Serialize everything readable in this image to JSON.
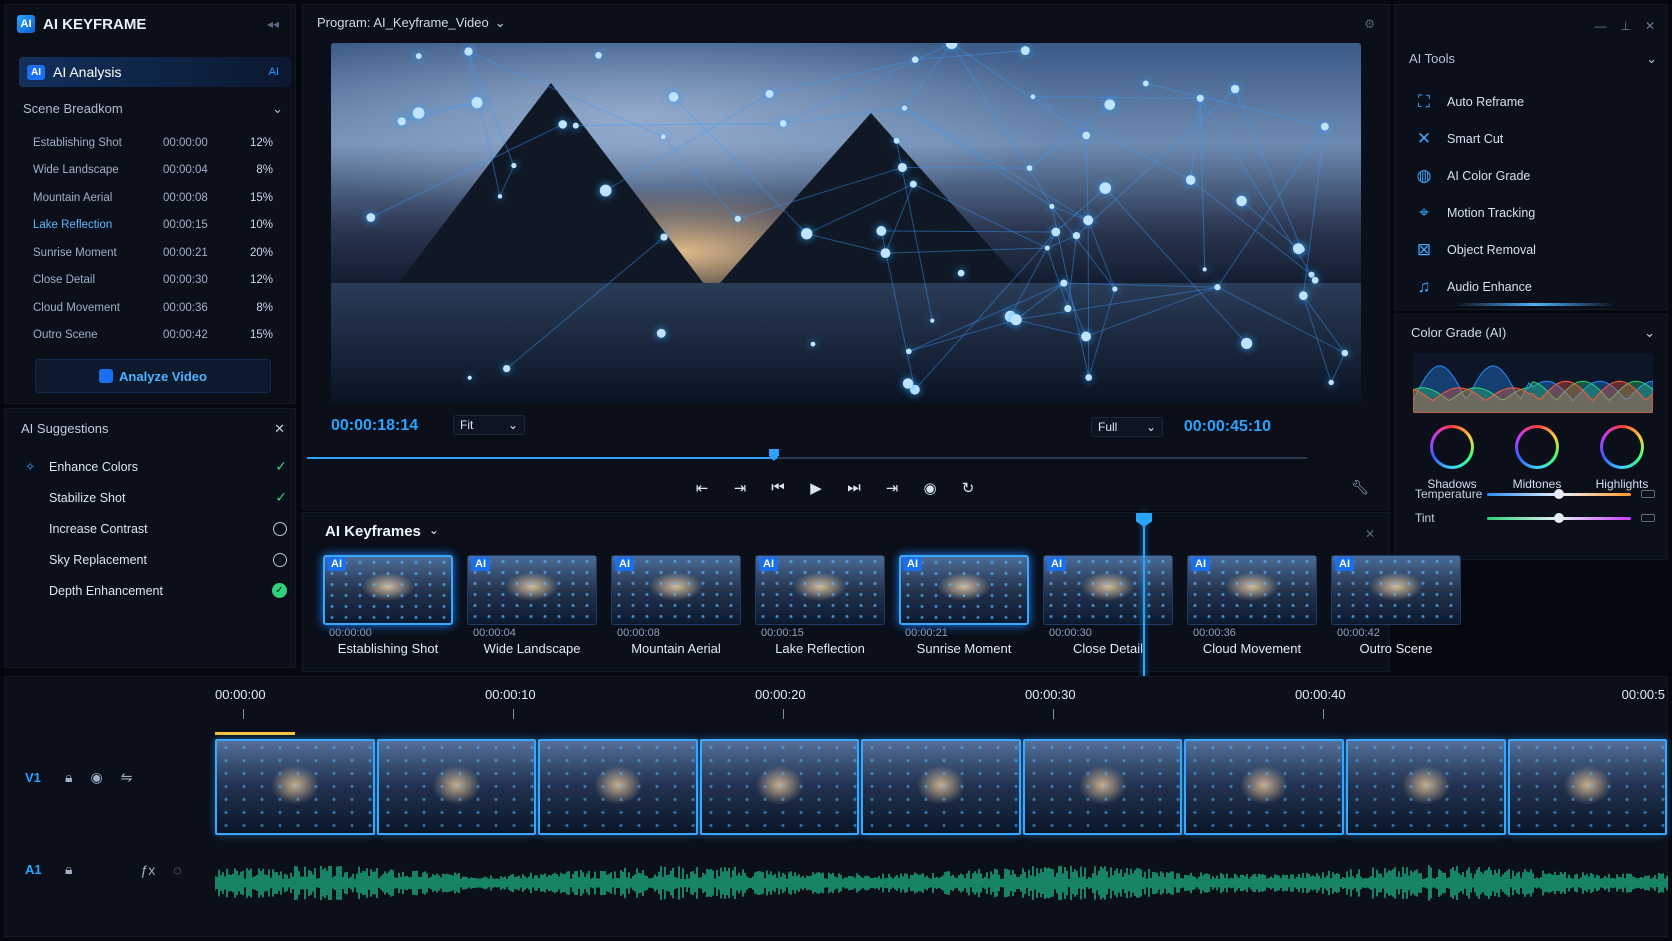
{
  "app": {
    "title": "AI KEYFRAME",
    "logo": "AI"
  },
  "left": {
    "tab": {
      "label": "AI Analysis",
      "chip": "AI",
      "right_badge": "AI"
    },
    "scene_breakdown": {
      "title": "Scene Breadkom",
      "items": [
        {
          "name": "Establishing Shot",
          "time": "00:00:00",
          "pct": "12%"
        },
        {
          "name": "Wide Landscape",
          "time": "00:00:04",
          "pct": "8%"
        },
        {
          "name": "Mountain Aerial",
          "time": "00:00:08",
          "pct": "15%"
        },
        {
          "name": "Lake Reflection",
          "time": "00:00:15",
          "pct": "10%"
        },
        {
          "name": "Sunrise Moment",
          "time": "00:00:21",
          "pct": "20%"
        },
        {
          "name": "Close Detail",
          "time": "00:00:30",
          "pct": "12%"
        },
        {
          "name": "Cloud Movement",
          "time": "00:00:36",
          "pct": "8%"
        },
        {
          "name": "Outro Scene",
          "time": "00:00:42",
          "pct": "15%"
        }
      ],
      "button": "Analyze Video"
    },
    "suggestions": {
      "title": "AI Suggestions",
      "items": [
        {
          "label": "Enhance Colors",
          "state": "checked"
        },
        {
          "label": "Stabilize Shot",
          "state": "checked"
        },
        {
          "label": "Increase Contrast",
          "state": "empty"
        },
        {
          "label": "Sky Replacement",
          "state": "empty"
        },
        {
          "label": "Depth Enhancement",
          "state": "filled"
        }
      ]
    }
  },
  "monitor": {
    "title": "Program: AI_Keyframe_Video",
    "timecode_current": "00:00:18:14",
    "fit": "Fit",
    "quality": "Full",
    "timecode_total": "00:00:45:10"
  },
  "tools": {
    "title": "AI Tools",
    "items": [
      {
        "label": "Auto Reframe",
        "icon": "reframe-icon",
        "glyph": "⛶"
      },
      {
        "label": "Smart Cut",
        "icon": "scissors-icon",
        "glyph": "✕"
      },
      {
        "label": "AI Color Grade",
        "icon": "palette-icon",
        "glyph": "◍"
      },
      {
        "label": "Motion Tracking",
        "icon": "target-icon",
        "glyph": "⌖"
      },
      {
        "label": "Object Removal",
        "icon": "object-icon",
        "glyph": "⊠"
      },
      {
        "label": "Audio Enhance",
        "icon": "music-icon",
        "glyph": "♫"
      }
    ]
  },
  "grade": {
    "title": "Color Grade (AI)",
    "wheels": [
      "Shadows",
      "Midtones",
      "Highlights"
    ],
    "sliders": [
      {
        "label": "Temperature",
        "value": 0.5
      },
      {
        "label": "Tint",
        "value": 0.5
      }
    ]
  },
  "keyframes": {
    "title": "AI Keyframes",
    "chip": "AI",
    "items": [
      {
        "name": "Establishing Shot",
        "time": "00:00:00",
        "active": true
      },
      {
        "name": "Wide Landscape",
        "time": "00:00:04",
        "active": false
      },
      {
        "name": "Mountain Aerial",
        "time": "00:00:08",
        "active": false
      },
      {
        "name": "Lake Reflection",
        "time": "00:00:15",
        "active": false
      },
      {
        "name": "Sunrise Moment",
        "time": "00:00:21",
        "active": true
      },
      {
        "name": "Close Detail",
        "time": "00:00:30",
        "active": false
      },
      {
        "name": "Cloud Movement",
        "time": "00:00:36",
        "active": false
      },
      {
        "name": "Outro Scene",
        "time": "00:00:42",
        "active": false
      }
    ]
  },
  "timeline": {
    "ticks": [
      "00:00:00",
      "00:00:10",
      "00:00:20",
      "00:00:30",
      "00:00:40",
      "00:00:5"
    ],
    "video_track": "V1",
    "audio_track": "A1",
    "clip_count": 9
  }
}
